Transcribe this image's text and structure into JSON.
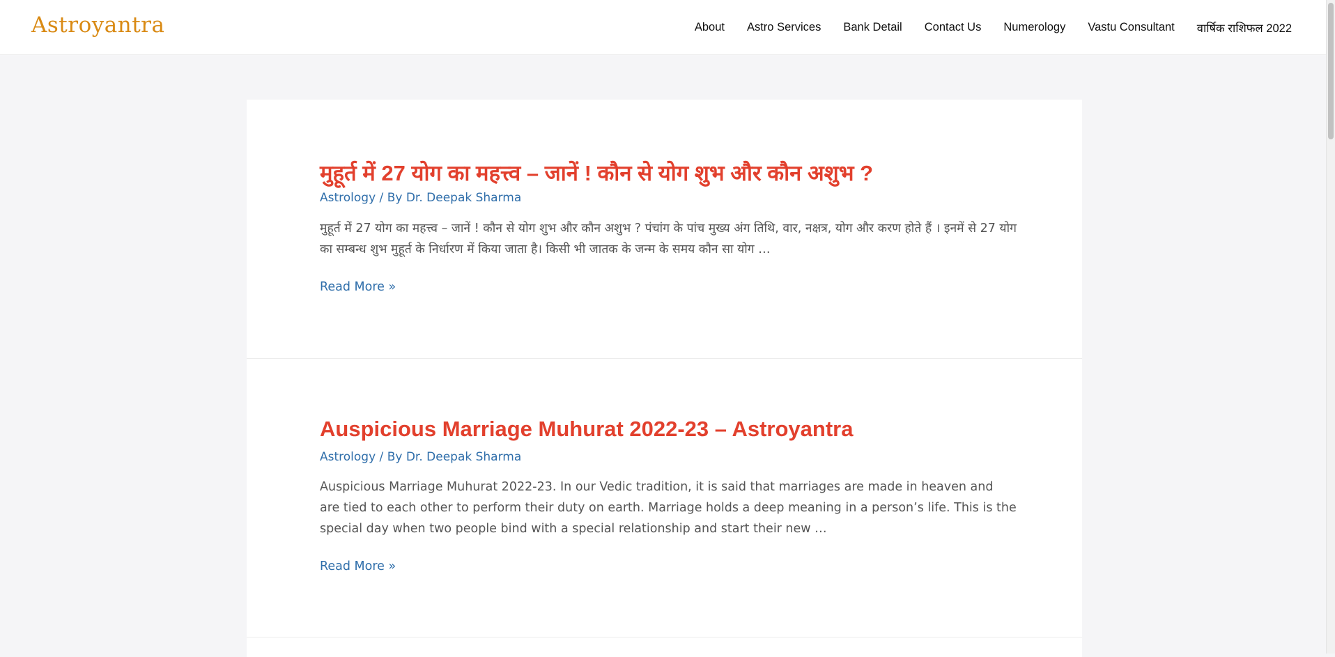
{
  "header": {
    "logo_text": "Astroyantra",
    "nav": [
      "About",
      "Astro Services",
      "Bank Detail",
      "Contact Us",
      "Numerology",
      "Vastu Consultant",
      "वार्षिक राशिफल 2022"
    ]
  },
  "posts": [
    {
      "title": "मुहूर्त में 27 योग का महत्त्व – जानें ! कौन से योग शुभ और कौन अशुभ ?",
      "category": "Astrology",
      "by": " / By ",
      "author": "Dr. Deepak Sharma",
      "excerpt": "मुहूर्त में 27 योग का महत्त्व – जानें ! कौन से योग शुभ और कौन अशुभ ? पंचांग के पांच मुख्य अंग तिथि, वार, नक्षत्र, योग और करण होते हैं । इनमें से 27 योग का सम्बन्ध शुभ मुहूर्त के निर्धारण में किया जाता है। किसी भी जातक के जन्म के समय कौन सा योग …",
      "read_more": "Read More »"
    },
    {
      "title": "Auspicious Marriage Muhurat 2022-23 – Astroyantra",
      "category": "Astrology",
      "by": " / By ",
      "author": "Dr. Deepak Sharma",
      "excerpt": "Auspicious Marriage Muhurat 2022-23. In our Vedic tradition, it is said that marriages are made in heaven and are tied to each other to perform their duty on earth. Marriage holds a deep meaning in a person’s life. This is the special day when two people bind with a special relationship and start their new …",
      "read_more": "Read More »"
    }
  ],
  "colors": {
    "title": "#e2402d",
    "link": "#2f6eaa",
    "logo": "#d98a14",
    "page_bg": "#f5f5f7"
  }
}
